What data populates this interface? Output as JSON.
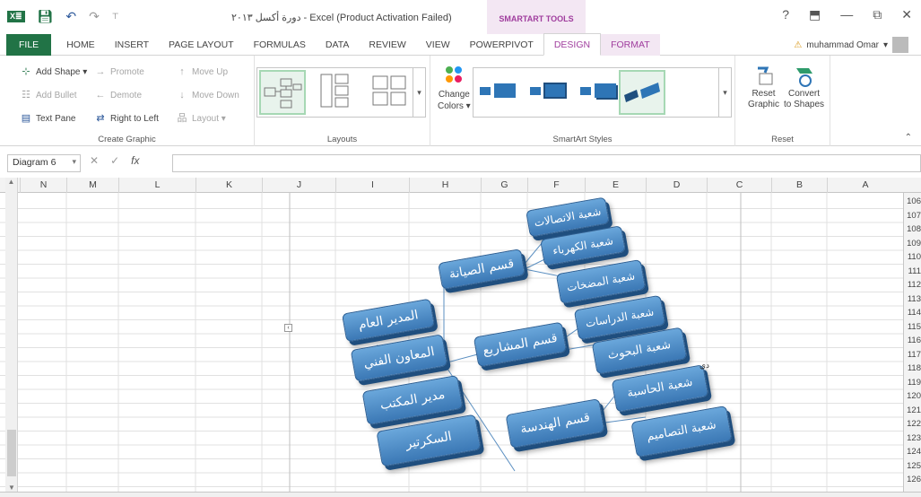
{
  "window": {
    "title": "دورة أكسل ٢٠١٣ - Excel (Product Activation Failed)",
    "contextual_tab": "SMARTART TOOLS",
    "help": "?",
    "ribbon_display": "⬒",
    "minimize": "—",
    "restore": "⧉",
    "close": "✕"
  },
  "tabs": [
    "FILE",
    "HOME",
    "INSERT",
    "PAGE LAYOUT",
    "FORMULAS",
    "DATA",
    "REVIEW",
    "VIEW",
    "POWERPIVOT",
    "DESIGN",
    "FORMAT"
  ],
  "user": {
    "warning": "⚠",
    "name": "muhammad Omar",
    "caret": "▾"
  },
  "ribbon": {
    "create_graphic": {
      "label": "Create Graphic",
      "add_shape": "Add Shape ▾",
      "add_bullet": "Add Bullet",
      "text_pane": "Text Pane",
      "promote": "Promote",
      "demote": "Demote",
      "right_to_left": "Right to Left",
      "move_up": "Move Up",
      "move_down": "Move Down",
      "layout": "Layout ▾"
    },
    "layouts": {
      "label": "Layouts"
    },
    "change_colors": {
      "line1": "Change",
      "line2": "Colors ▾"
    },
    "styles": {
      "label": "SmartArt Styles"
    },
    "reset": {
      "label": "Reset",
      "reset_graphic_1": "Reset",
      "reset_graphic_2": "Graphic",
      "convert_1": "Convert",
      "convert_2": "to Shapes"
    },
    "collapse": "⌃"
  },
  "formula_bar": {
    "name_box": "Diagram 6",
    "cancel": "✕",
    "enter": "✓",
    "fx": "fx",
    "value": ""
  },
  "columns": [
    "N",
    "M",
    "L",
    "K",
    "J",
    "I",
    "H",
    "G",
    "F",
    "E",
    "D",
    "C",
    "B",
    "A"
  ],
  "rows": [
    "106",
    "107",
    "108",
    "109",
    "110",
    "111",
    "112",
    "113",
    "114",
    "115",
    "116",
    "117",
    "118",
    "119",
    "120",
    "121",
    "122",
    "123",
    "124",
    "125",
    "126"
  ],
  "diagram": {
    "shapes": {
      "general_manager": "المدير العام",
      "tech_assistant": "المعاون الفني",
      "office_manager": "مدير المكتب",
      "secretary": "السكرتير",
      "maintenance": "قسم الصيانة",
      "projects": "قسم المشاريع",
      "engineering": "قسم الهندسة",
      "comms": "شعبة الاتصالات",
      "electric": "شعبة الكهرباء",
      "pumps": "شعبة المضخات",
      "studies": "شعبة الدراسات",
      "research": "شعبة البحوث",
      "computer": "شعبة الحاسبة",
      "designs": "شعبة التصاميم"
    },
    "stray_label": "دي"
  }
}
